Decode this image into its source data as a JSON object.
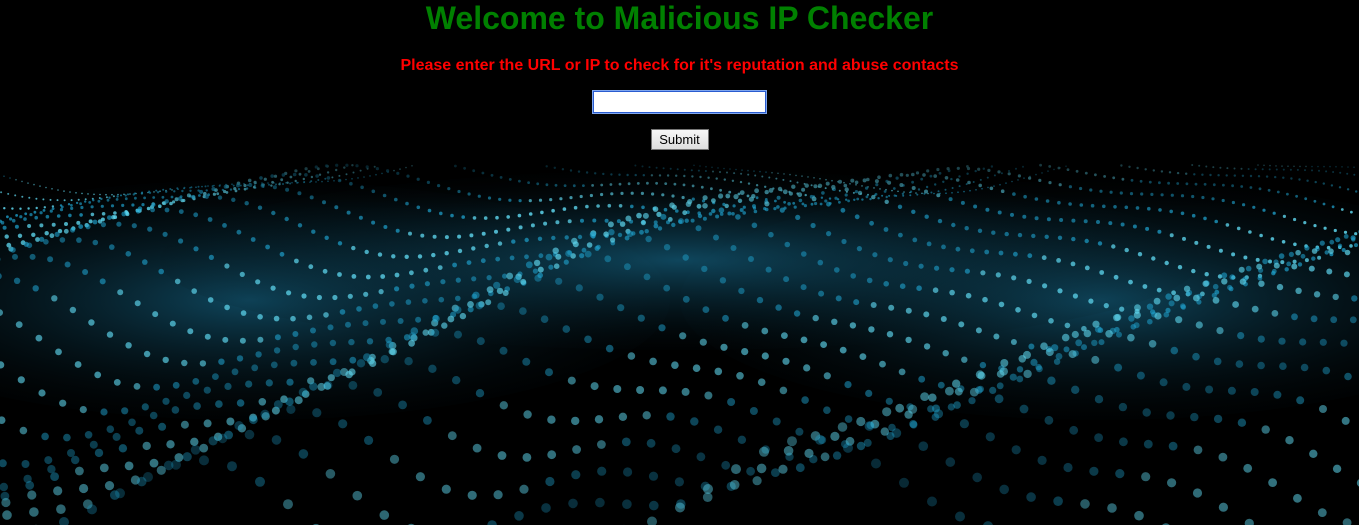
{
  "page": {
    "title": "Welcome to Malicious IP Checker",
    "instructions": "Please enter the URL or IP to check for it's reputation and abuse contacts"
  },
  "form": {
    "input_value": "",
    "submit_label": "Submit"
  },
  "colors": {
    "background": "#000000",
    "title": "#008000",
    "instructions": "#ff0000",
    "wave_primary": "#1fa3cf",
    "wave_highlight": "#5fd8f0"
  }
}
